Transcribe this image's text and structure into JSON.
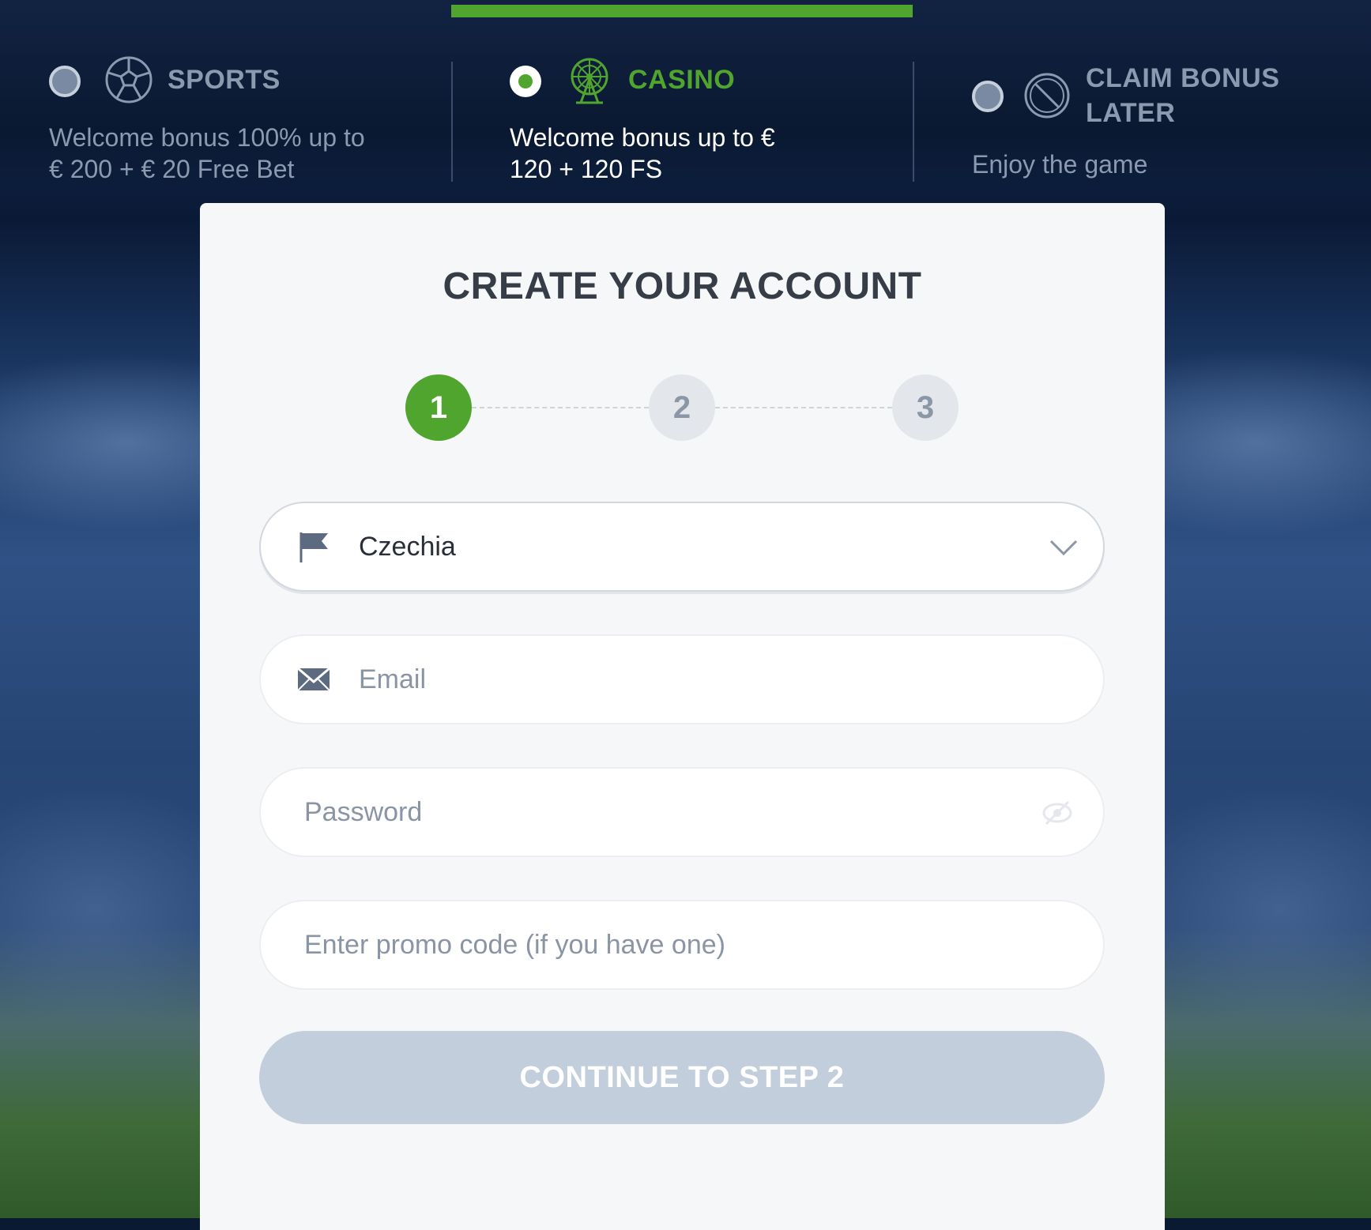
{
  "colors": {
    "accent": "#4fa52e",
    "muted": "#8c9ab0",
    "button_disabled": "#c3cedc",
    "card_bg": "#f6f7f8"
  },
  "bonus_options": [
    {
      "id": "sports",
      "icon": "soccer-ball-icon",
      "title": "SPORTS",
      "description_lines": [
        "Welcome bonus 100% up to",
        "€ 200 + € 20 Free Bet"
      ],
      "selected": false
    },
    {
      "id": "casino",
      "icon": "ferris-wheel-icon",
      "title": "CASINO",
      "description_lines": [
        "Welcome bonus up to €",
        "120 + 120 FS"
      ],
      "selected": true
    },
    {
      "id": "later",
      "icon": "no-sign-icon",
      "title_lines": [
        "CLAIM BONUS",
        "LATER"
      ],
      "description_lines": [
        "Enjoy the game"
      ],
      "selected": false
    }
  ],
  "form": {
    "title": "CREATE YOUR ACCOUNT",
    "steps": [
      {
        "label": "1",
        "active": true
      },
      {
        "label": "2",
        "active": false
      },
      {
        "label": "3",
        "active": false
      }
    ],
    "country": {
      "value": "Czechia",
      "icon": "flag-icon",
      "toggle_icon": "chevron-down-icon"
    },
    "email": {
      "placeholder": "Email",
      "icon": "envelope-icon"
    },
    "password": {
      "placeholder": "Password",
      "toggle_icon": "eye-hidden-icon"
    },
    "promo": {
      "placeholder": "Enter promo code (if you have one)"
    },
    "submit_label": "CONTINUE TO STEP 2"
  }
}
